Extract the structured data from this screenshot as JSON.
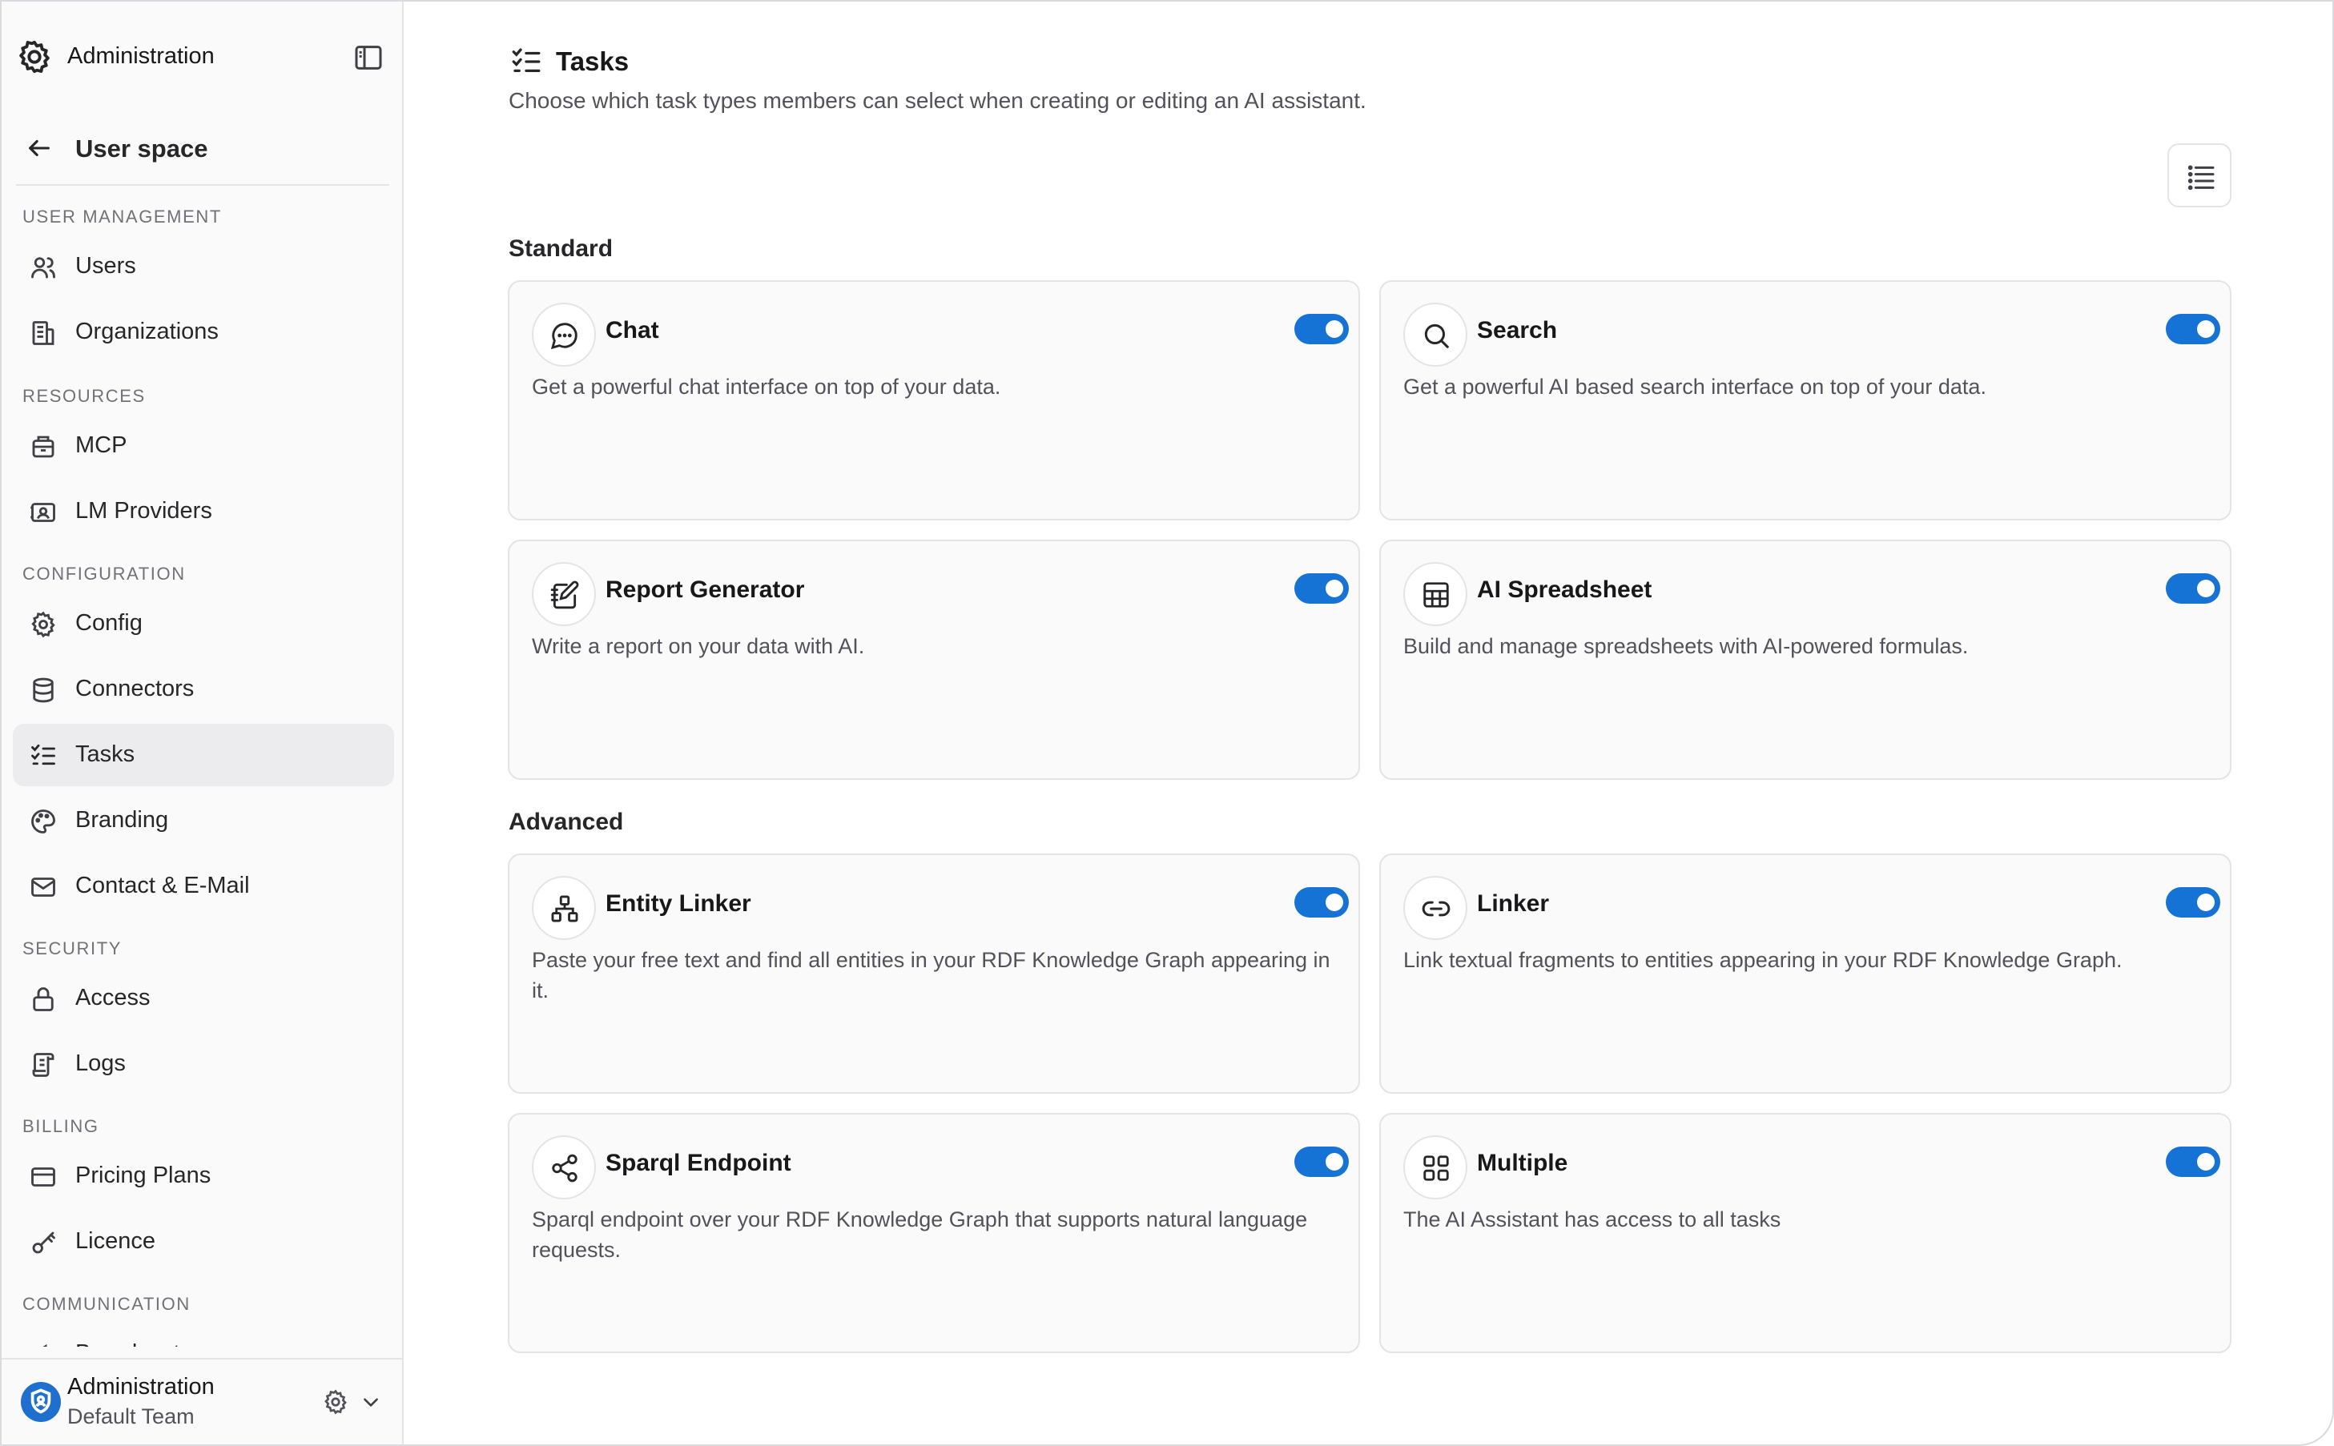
{
  "sidebar": {
    "app_title": "Administration",
    "back_label": "User space",
    "sections": [
      {
        "title": "User management",
        "items": [
          {
            "label": "Users",
            "icon": "users-icon"
          },
          {
            "label": "Organizations",
            "icon": "building-icon"
          }
        ]
      },
      {
        "title": "Resources",
        "items": [
          {
            "label": "MCP",
            "icon": "package-icon"
          },
          {
            "label": "LM Providers",
            "icon": "server-icon"
          }
        ]
      },
      {
        "title": "Configuration",
        "items": [
          {
            "label": "Config",
            "icon": "gear-icon"
          },
          {
            "label": "Connectors",
            "icon": "database-icon"
          },
          {
            "label": "Tasks",
            "icon": "checklist-icon",
            "active": true
          },
          {
            "label": "Branding",
            "icon": "palette-icon"
          },
          {
            "label": "Contact & E-Mail",
            "icon": "mail-icon"
          }
        ]
      },
      {
        "title": "Security",
        "items": [
          {
            "label": "Access",
            "icon": "lock-icon"
          },
          {
            "label": "Logs",
            "icon": "scroll-icon"
          }
        ]
      },
      {
        "title": "Billing",
        "items": [
          {
            "label": "Pricing Plans",
            "icon": "credit-card-icon"
          },
          {
            "label": "Licence",
            "icon": "key-icon"
          }
        ]
      },
      {
        "title": "Communication",
        "items": [
          {
            "label": "Broadcast",
            "icon": "megaphone-icon"
          }
        ]
      }
    ],
    "footer": {
      "team_title": "Administration",
      "team_subtitle": "Default Team"
    }
  },
  "main": {
    "title": "Tasks",
    "description": "Choose which task types members can select when creating or editing an AI assistant.",
    "groups": [
      {
        "title": "Standard",
        "cards": [
          {
            "title": "Chat",
            "description": "Get a powerful chat interface on top of your data.",
            "icon": "chat-bubble-icon",
            "enabled": true
          },
          {
            "title": "Search",
            "description": "Get a powerful AI based search interface on top of your data.",
            "icon": "search-icon",
            "enabled": true
          },
          {
            "title": "Report Generator",
            "description": "Write a report on your data with AI.",
            "icon": "notebook-pen-icon",
            "enabled": true
          },
          {
            "title": "AI Spreadsheet",
            "description": "Build and manage spreadsheets with AI-powered formulas.",
            "icon": "spreadsheet-icon",
            "enabled": true
          }
        ]
      },
      {
        "title": "Advanced",
        "cards": [
          {
            "title": "Entity Linker",
            "description": "Paste your free text and find all entities in your RDF Knowledge Graph appearing in it.",
            "icon": "network-icon",
            "enabled": true
          },
          {
            "title": "Linker",
            "description": "Link textual fragments to entities appearing in your RDF Knowledge Graph.",
            "icon": "link-icon",
            "enabled": true
          },
          {
            "title": "Sparql Endpoint",
            "description": "Sparql endpoint over your RDF Knowledge Graph that supports natural language requests.",
            "icon": "share-icon",
            "enabled": true
          },
          {
            "title": "Multiple",
            "description": "The AI Assistant has access to all tasks",
            "icon": "grid-icon",
            "enabled": true
          }
        ]
      }
    ]
  },
  "colors": {
    "accent": "#1473d4",
    "active_bg": "#ececee",
    "card_bg": "#fafafa",
    "border": "#e4e4e7"
  }
}
